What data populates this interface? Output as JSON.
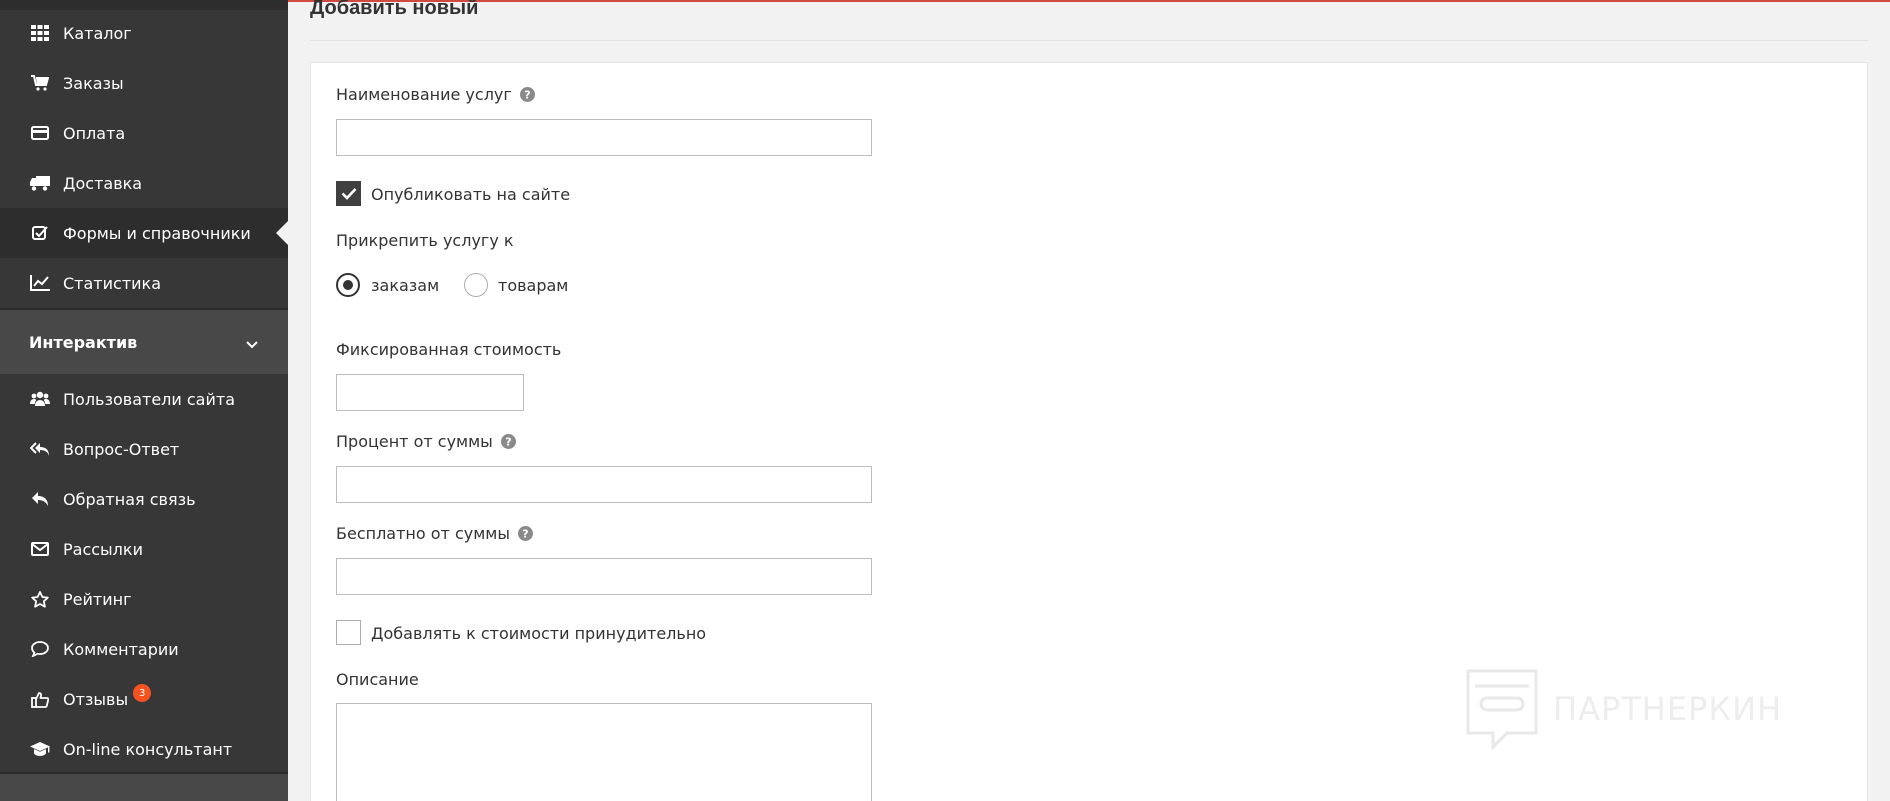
{
  "sidebar": {
    "items_top": [
      {
        "label": "Каталог",
        "icon": "grid-icon"
      },
      {
        "label": "Заказы",
        "icon": "cart-icon"
      },
      {
        "label": "Оплата",
        "icon": "credit-card-icon"
      },
      {
        "label": "Доставка",
        "icon": "truck-icon"
      },
      {
        "label": "Формы и справочники",
        "icon": "check-square-icon"
      },
      {
        "label": "Статистика",
        "icon": "line-chart-icon"
      }
    ],
    "group": {
      "label": "Интерактив",
      "icon": "chevron-down-icon"
    },
    "items_group": [
      {
        "label": "Пользователи сайта",
        "icon": "users-icon"
      },
      {
        "label": "Вопрос-Ответ",
        "icon": "reply-all-icon"
      },
      {
        "label": "Обратная связь",
        "icon": "reply-icon"
      },
      {
        "label": "Рассылки",
        "icon": "envelope-icon"
      },
      {
        "label": "Рейтинг",
        "icon": "star-icon"
      },
      {
        "label": "Комментарии",
        "icon": "comment-icon"
      },
      {
        "label": "Отзывы",
        "icon": "thumbs-up-icon",
        "badge": "3"
      },
      {
        "label": "On-line консультант",
        "icon": "graduation-cap-icon"
      }
    ]
  },
  "page": {
    "title": "Добавить новый"
  },
  "form": {
    "name_label": "Наименование услуг",
    "name_value": "",
    "publish_label": "Опубликовать на сайте",
    "publish_checked": true,
    "attach_label": "Прикрепить услугу к",
    "radio_orders": "заказам",
    "radio_products": "товарам",
    "fixed_label": "Фиксированная стоимость",
    "fixed_value": "",
    "percent_label": "Процент от суммы",
    "percent_value": "",
    "free_label": "Бесплатно от суммы",
    "free_value": "",
    "force_label": "Добавлять к стоимости принудительно",
    "force_checked": false,
    "desc_label": "Описание",
    "desc_value": ""
  },
  "watermark": {
    "text": "ПАРТНЕРКИН"
  },
  "colors": {
    "sidebar": "#373737",
    "active": "#2d2d2d",
    "group": "#484848",
    "accent_line": "#d04a3f",
    "badge": "#f5521f"
  }
}
